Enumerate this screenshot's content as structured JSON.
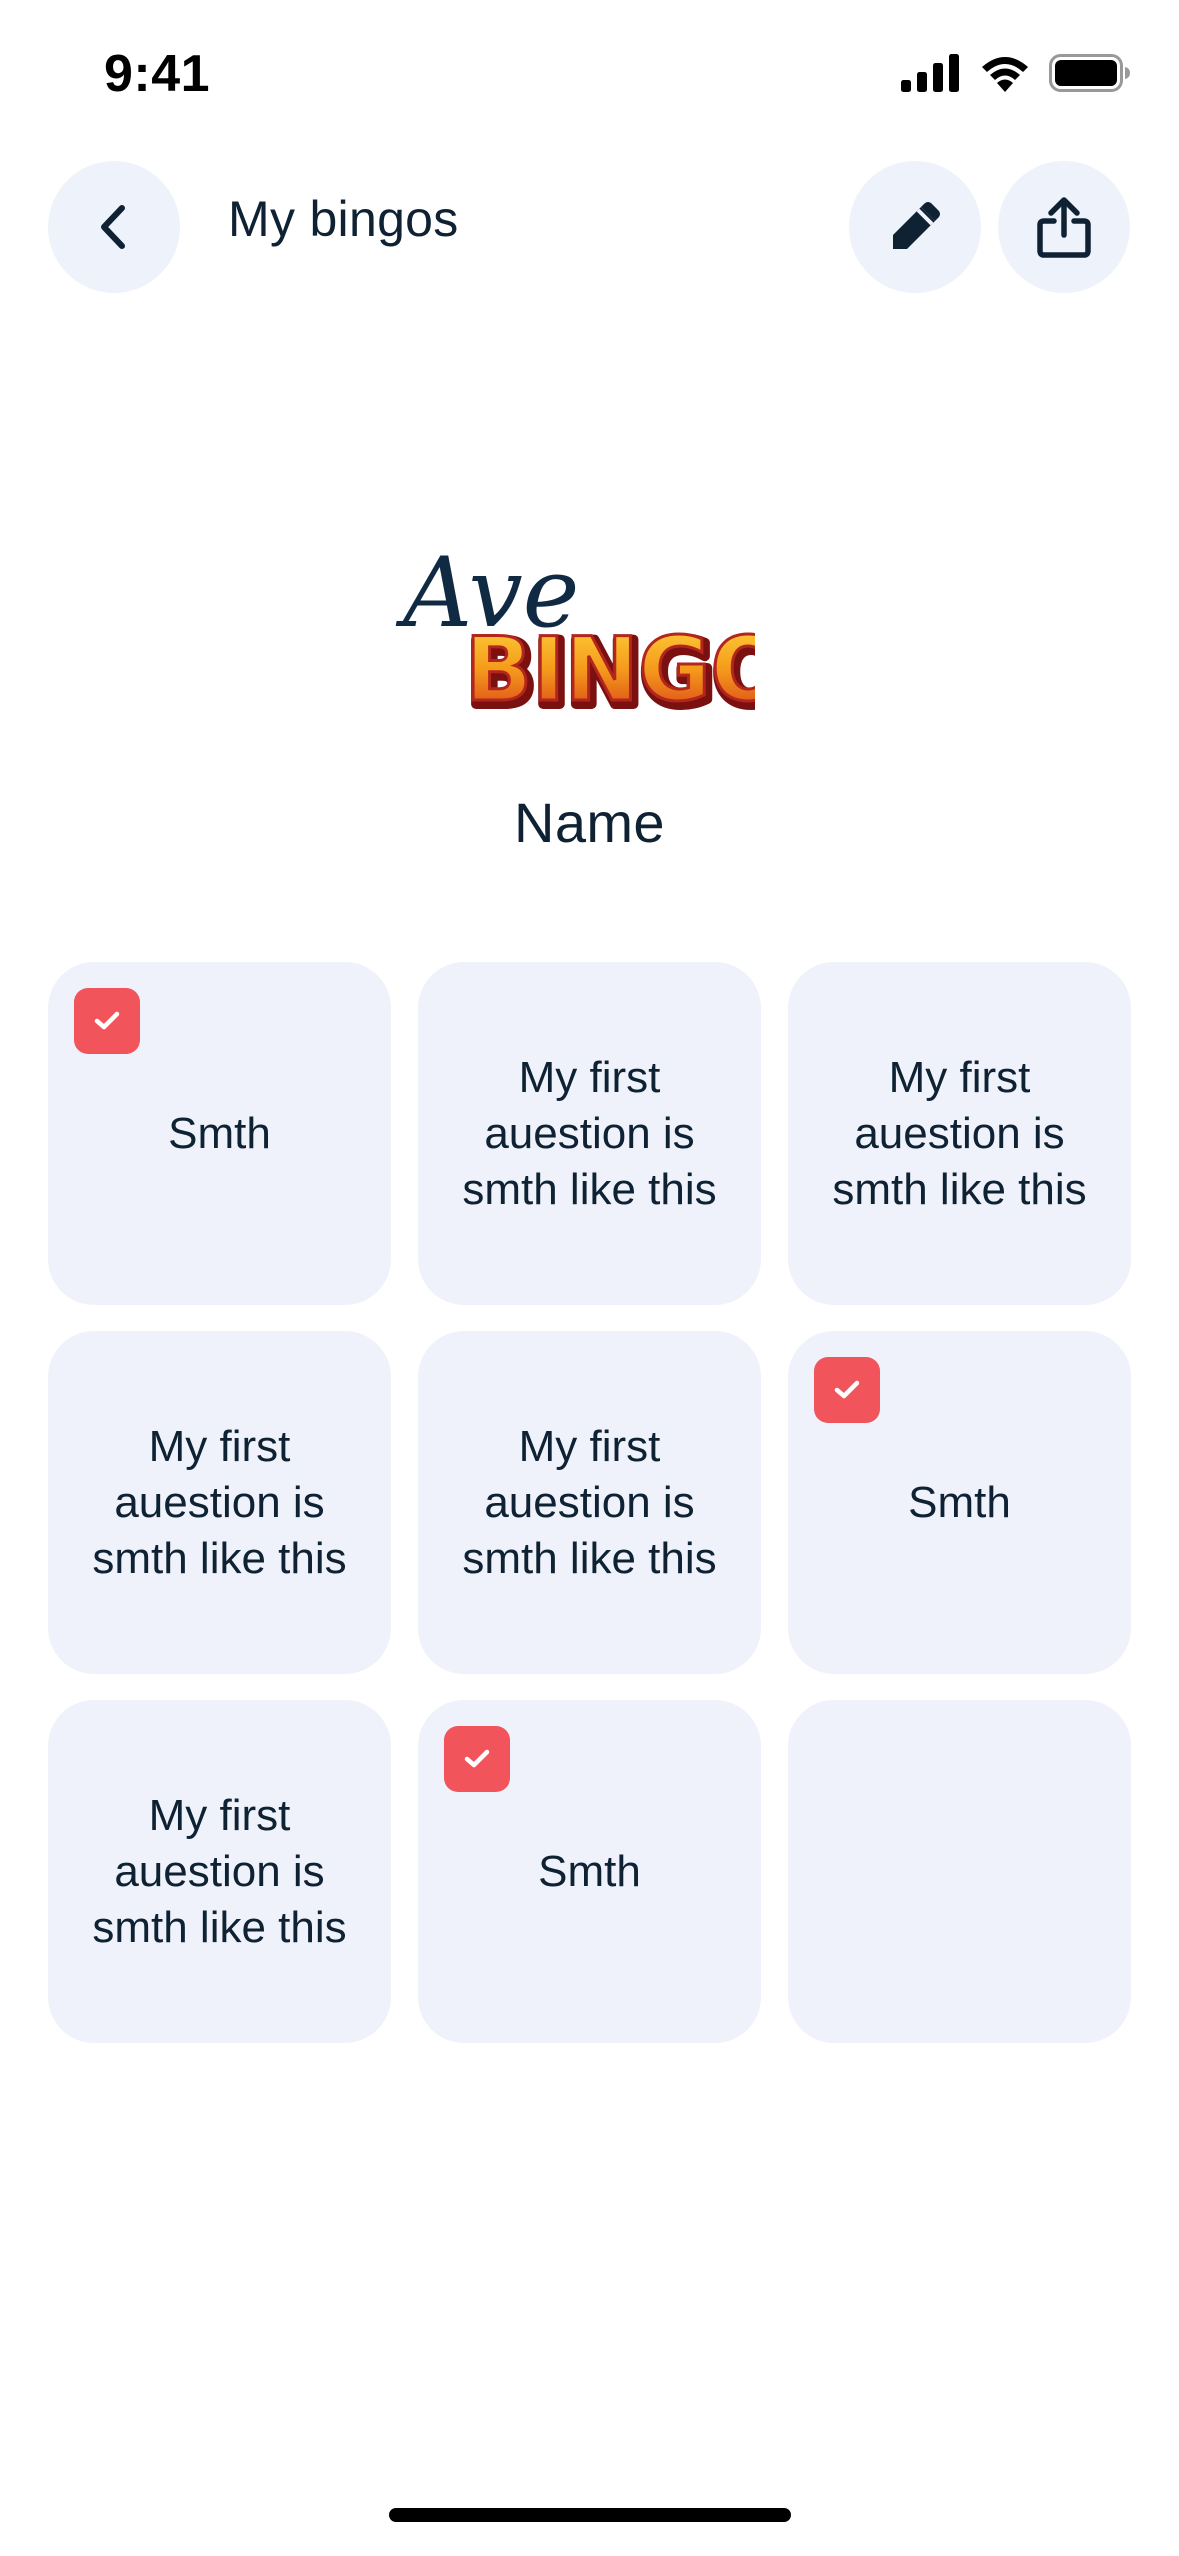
{
  "status_bar": {
    "time": "9:41",
    "icons": [
      "cellular-signal-icon",
      "wifi-icon",
      "battery-icon"
    ]
  },
  "header": {
    "title": "My bingos",
    "back_icon": "chevron-left-icon",
    "edit_icon": "pencil-icon",
    "share_icon": "share-icon"
  },
  "logo": {
    "script_text": "Ave",
    "bold_text": "BINGO"
  },
  "card": {
    "name": "Name"
  },
  "grid": {
    "cells": [
      {
        "text": "Smth",
        "checked": true
      },
      {
        "text": "My first auestion is smth like this",
        "checked": false
      },
      {
        "text": "My first auestion is smth like this",
        "checked": false
      },
      {
        "text": "My first auestion is smth like this",
        "checked": false
      },
      {
        "text": "My first auestion is smth like this",
        "checked": false
      },
      {
        "text": "Smth",
        "checked": true
      },
      {
        "text": "My first auestion is smth like this",
        "checked": false
      },
      {
        "text": "Smth",
        "checked": true
      },
      {
        "text": "",
        "checked": false
      }
    ]
  },
  "colors": {
    "accent_red": "#f2545b",
    "cell_background": "#eff2fb",
    "text_dark": "#0f2233"
  }
}
